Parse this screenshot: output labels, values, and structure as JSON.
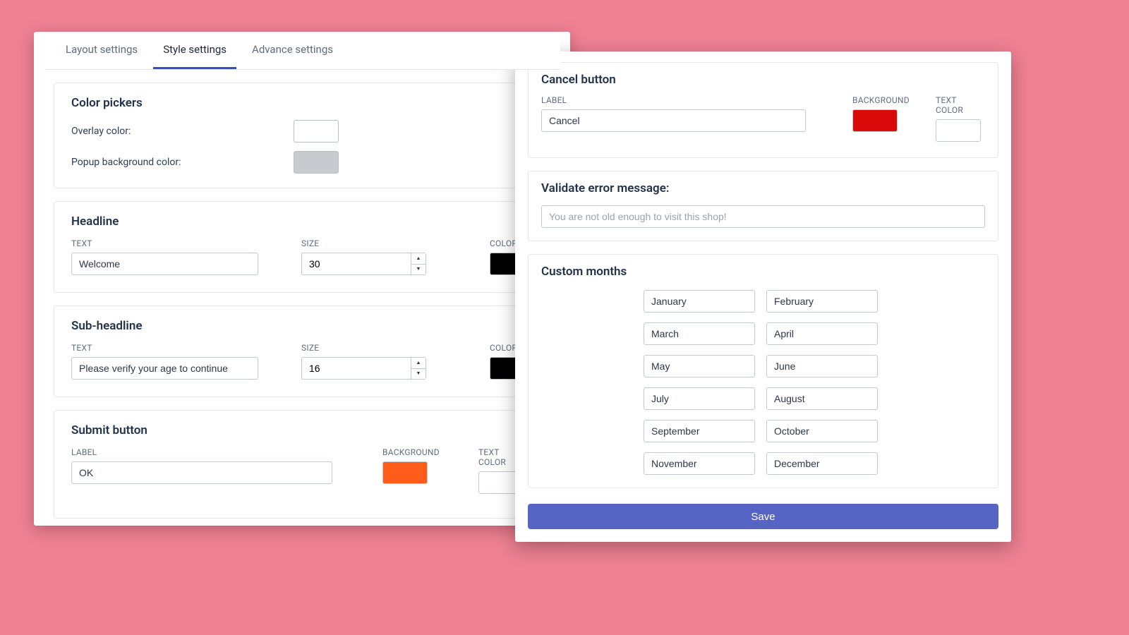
{
  "tabs": {
    "layout": "Layout settings",
    "style": "Style settings",
    "advance": "Advance settings"
  },
  "color_pickers": {
    "title": "Color pickers",
    "overlay_label": "Overlay color:",
    "overlay_color": "#ffffff",
    "popup_bg_label": "Popup background color:",
    "popup_bg_color": "#c7cbcf"
  },
  "headline": {
    "title": "Headline",
    "text_label": "TEXT",
    "text_value": "Welcome",
    "size_label": "SIZE",
    "size_value": "30",
    "color_label": "COLOR",
    "color_value": "#000000"
  },
  "sub_headline": {
    "title": "Sub-headline",
    "text_label": "TEXT",
    "text_value": "Please verify your age to continue",
    "size_label": "SIZE",
    "size_value": "16",
    "color_label": "COLOR",
    "color_value": "#000000"
  },
  "submit_button": {
    "title": "Submit button",
    "label_label": "LABEL",
    "label_value": "OK",
    "bg_label": "BACKGROUND",
    "bg_value": "#ff5b19",
    "tc_label": "TEXT COLOR",
    "tc_value": "#ffffff"
  },
  "cancel_button": {
    "title": "Cancel button",
    "label_label": "LABEL",
    "label_value": "Cancel",
    "bg_label": "BACKGROUND",
    "bg_value": "#d90909",
    "tc_label": "TEXT COLOR",
    "tc_value": "#ffffff"
  },
  "validate": {
    "title": "Validate error message:",
    "placeholder": "You are not old enough to visit this shop!"
  },
  "custom_months": {
    "title": "Custom months",
    "values": [
      "January",
      "February",
      "March",
      "April",
      "May",
      "June",
      "July",
      "August",
      "September",
      "October",
      "November",
      "December"
    ]
  },
  "save_label": "Save"
}
